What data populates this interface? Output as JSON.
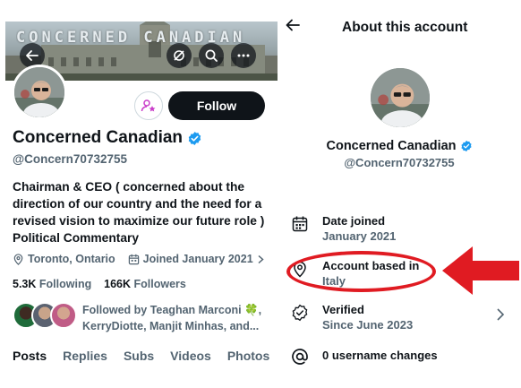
{
  "left": {
    "banner_text": "CONCERNED CANADIAN",
    "follow_label": "Follow",
    "display_name": "Concerned Canadian",
    "handle": "@Concern70732755",
    "bio": "Chairman & CEO ( concerned about the direction of our country and the need for a revised vision to maximize our future role ) Political Commentary",
    "location": "Toronto, Ontario",
    "joined": "Joined January 2021",
    "following_count": "5.3K",
    "following_label": "Following",
    "followers_count": "166K",
    "followers_label": "Followers",
    "followed_by": "Followed by Teaghan Marconi 🍀, KerryDiotte, Manjit Minhas, and...",
    "tabs": [
      {
        "label": "Posts",
        "active": true
      },
      {
        "label": "Replies",
        "active": false
      },
      {
        "label": "Subs",
        "active": false
      },
      {
        "label": "Videos",
        "active": false
      },
      {
        "label": "Photos",
        "active": false
      }
    ]
  },
  "right": {
    "title": "About this account",
    "display_name": "Concerned Canadian",
    "handle": "@Concern70732755",
    "rows": [
      {
        "icon": "calendar-icon",
        "label": "Date joined",
        "value": "January 2021"
      },
      {
        "icon": "location-pin-icon",
        "label": "Account based in",
        "value": "Italy"
      },
      {
        "icon": "verified-check-icon",
        "label": "Verified",
        "value": "Since June 2023"
      },
      {
        "icon": "at-sign-icon",
        "label": "0 username changes",
        "value": ""
      }
    ]
  },
  "colors": {
    "text": "#0f1419",
    "secondary": "#536471",
    "verified": "#1d9bf0",
    "annotation": "#e01b22",
    "subscribe_accent": "#c93ec9"
  }
}
